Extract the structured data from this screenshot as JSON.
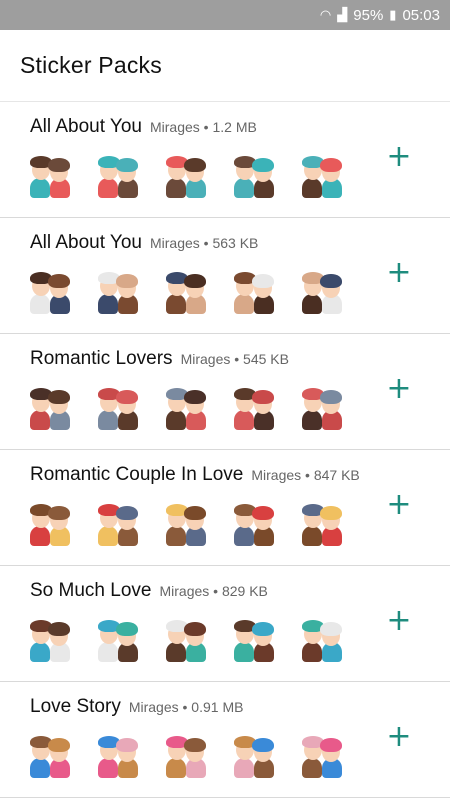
{
  "status_bar": {
    "battery": "95%",
    "time": "05:03",
    "icons": [
      "wifi-icon",
      "signal-icon",
      "battery-icon"
    ]
  },
  "app_bar": {
    "title": "Sticker Packs"
  },
  "packs": [
    {
      "name": "All About You",
      "meta": "Mirages • 1.2 MB"
    },
    {
      "name": "All About You",
      "meta": "Mirages • 563 KB"
    },
    {
      "name": "Romantic Lovers",
      "meta": "Mirages • 545 KB"
    },
    {
      "name": "Romantic Couple In Love",
      "meta": "Mirages • 847 KB"
    },
    {
      "name": "So Much Love",
      "meta": "Mirages • 829 KB"
    },
    {
      "name": "Love Story",
      "meta": "Mirages • 0.91 MB"
    }
  ],
  "add_label": "+",
  "colors": {
    "accent": "#1e8c7e",
    "status_bar": "#9e9e9e"
  }
}
